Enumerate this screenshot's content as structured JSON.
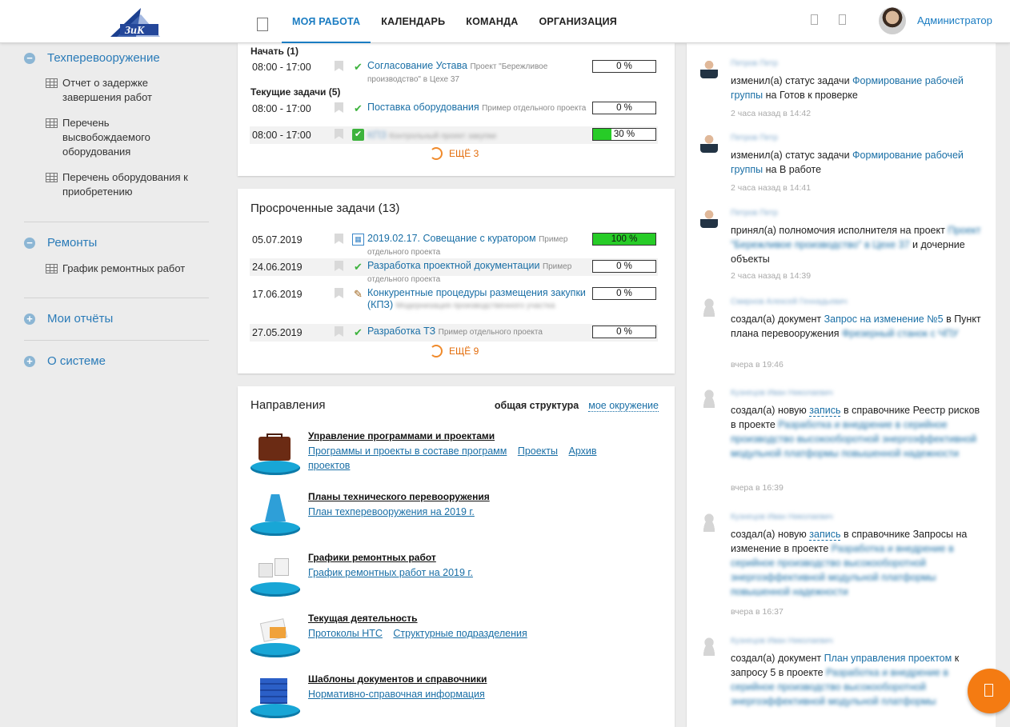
{
  "header": {
    "logo_text": "ЗиК",
    "nav": [
      {
        "label": "МОЯ РАБОТА",
        "active": true
      },
      {
        "label": "КАЛЕНДАРЬ",
        "active": false
      },
      {
        "label": "КОМАНДА",
        "active": false
      },
      {
        "label": "ОРГАНИЗАЦИЯ",
        "active": false
      }
    ],
    "user": "Администратор",
    "accent": "#1a7cc2"
  },
  "sidebar": {
    "sections": [
      {
        "icon": "minus-circle-icon",
        "title": "Техперевооружение",
        "items": [
          "Отчет о задержке завершения работ",
          "Перечень высвобождаемого оборудования",
          "Перечень оборудования к приобретению"
        ]
      },
      {
        "icon": "minus-circle-icon",
        "title": "Ремонты",
        "items": [
          "График ремонтных работ"
        ]
      },
      {
        "icon": "plus-circle-icon",
        "title": "Мои отчёты",
        "items": []
      },
      {
        "icon": "plus-circle-icon",
        "title": "О системе",
        "items": []
      }
    ]
  },
  "tasks": {
    "start_label": "Начать (1)",
    "current_label": "Текущие задачи (5)",
    "rows": [
      {
        "time": "08:00 - 17:00",
        "icon": "check-icon",
        "title": "Согласование Устава",
        "project": "Проект \"Бережливое производство\" в Цехе 37",
        "progress": "0 %",
        "progress_value": 0
      },
      {
        "time": "08:00 - 17:00",
        "icon": "check-icon",
        "title": "Поставка оборудования",
        "project": "Пример отдельного проекта",
        "progress": "0 %",
        "progress_value": 0
      },
      {
        "time": "08:00 - 17:00",
        "icon": "checkbox-icon",
        "title": "КПЗ",
        "project": "Контрольный проект закупки",
        "progress": "30 %",
        "progress_value": 30
      }
    ],
    "more": "ЕЩЁ 3"
  },
  "overdue": {
    "title": "Просроченные задачи (13)",
    "rows": [
      {
        "date": "05.07.2019",
        "icon": "calendar-icon",
        "title": "2019.02.17. Совещание с куратором",
        "project": "Пример отдельного проекта",
        "progress": "100 %",
        "progress_value": 100
      },
      {
        "date": "24.06.2019",
        "icon": "check-icon",
        "title": "Разработка проектной документации",
        "project": "Пример отдельного проекта",
        "progress": "0 %",
        "progress_value": 0
      },
      {
        "date": "17.06.2019",
        "icon": "hammer-icon",
        "title": "Конкурентные процедуры размещения закупки (КПЗ)",
        "project": "Модернизация производственного участка",
        "progress": "0 %",
        "progress_value": 0
      },
      {
        "date": "27.05.2019",
        "icon": "check-icon",
        "title": "Разработка ТЗ",
        "project": "Пример отдельного проекта",
        "progress": "0 %",
        "progress_value": 0
      }
    ],
    "more": "ЕЩЁ 9"
  },
  "directions": {
    "title": "Направления",
    "tab_active": "общая структура",
    "tab_link": "мое окружение",
    "items": [
      {
        "img": "briefcase-icon",
        "title": "Управление программами и проектами",
        "links": [
          "Программы и проекты в составе программ",
          "Проекты",
          "Архив проектов"
        ]
      },
      {
        "img": "plan-board-icon",
        "title": "Планы технического перевооружения",
        "links": [
          "План техперевооружения на 2019 г."
        ]
      },
      {
        "img": "puzzle-icon",
        "title": "Графики ремонтных работ",
        "links": [
          "График ремонтных работ на 2019 г."
        ]
      },
      {
        "img": "documents-icon",
        "title": "Текущая деятельность",
        "links": [
          "Протоколы НТС",
          "Структурные подразделения"
        ]
      },
      {
        "img": "binders-icon",
        "title": "Шаблоны документов и справочники",
        "links": [
          "Нормативно-справочная информация"
        ]
      }
    ]
  },
  "feed": [
    {
      "avatar": "user-photo-icon",
      "name": "Петров Петр",
      "pre": "изменил(а) статус ",
      "kw": "задачи",
      "link": "Формирование рабочей группы",
      "mid": " на ",
      "tail": "Готов к проверке",
      "time": "2 часа назад в 14:42"
    },
    {
      "avatar": "user-photo-icon",
      "name": "Петров Петр",
      "pre": "изменил(а) статус ",
      "kw": "задачи",
      "link": "Формирование рабочей группы",
      "mid": " на ",
      "tail": "В работе",
      "time": "2 часа назад в 14:41"
    },
    {
      "avatar": "user-photo-icon",
      "name": "Петров Петр",
      "pre": "принял(а) полномочия исполнителя на ",
      "kw": "проект",
      "link": "Проект \"Бережливое производство\" в Цехе 37",
      "mid": " и",
      "tail": "дочерние объекты",
      "time": "2 часа назад в 14:39"
    },
    {
      "avatar": "user-placeholder-icon",
      "name": "Смирнов Алексей Геннадьевич",
      "pre": "создал(а) ",
      "kw": "документ",
      "link": "Запрос на изменение №5",
      "mid": " в ",
      "tail": "Пункт плана перевооружения",
      "blur": "Фрезерный станок с ЧПУ",
      "time": "вчера в 19:46"
    },
    {
      "avatar": "user-placeholder-icon",
      "name": "Кузнецов Иван Николаевич",
      "pre": "создал(а) новую ",
      "kw": "запись",
      "link": "",
      "mid": " в справочнике ",
      "tail": "Реестр рисков в проекте",
      "blur": "Разработка и внедрение в серийное производство высокооборотной энергоэффективной модульной платформы повышенной надежности",
      "time": "вчера в 16:39"
    },
    {
      "avatar": "user-placeholder-icon",
      "name": "Кузнецов Иван Николаевич",
      "pre": "создал(а) новую ",
      "kw": "запись",
      "link": "",
      "mid": " в справочнике ",
      "tail": "Запросы на изменение в проекте",
      "blur": "Разработка и внедрение в серийное производство высокооборотной энергоэффективной модульной платформы повышенной надежности",
      "time": "вчера в 16:37"
    },
    {
      "avatar": "user-placeholder-icon",
      "name": "Кузнецов Иван Николаевич",
      "pre": "создал(а) ",
      "kw": "документ",
      "link": "План управления проектом",
      "mid": "",
      "tail": "к запросу 5 в проекте",
      "blur": "Разработка и внедрение в серийное производство высокооборотной энергоэффективной модульной платформы",
      "time": ""
    }
  ],
  "fab": {
    "icon": "phone-icon",
    "color": "#f47b12"
  }
}
